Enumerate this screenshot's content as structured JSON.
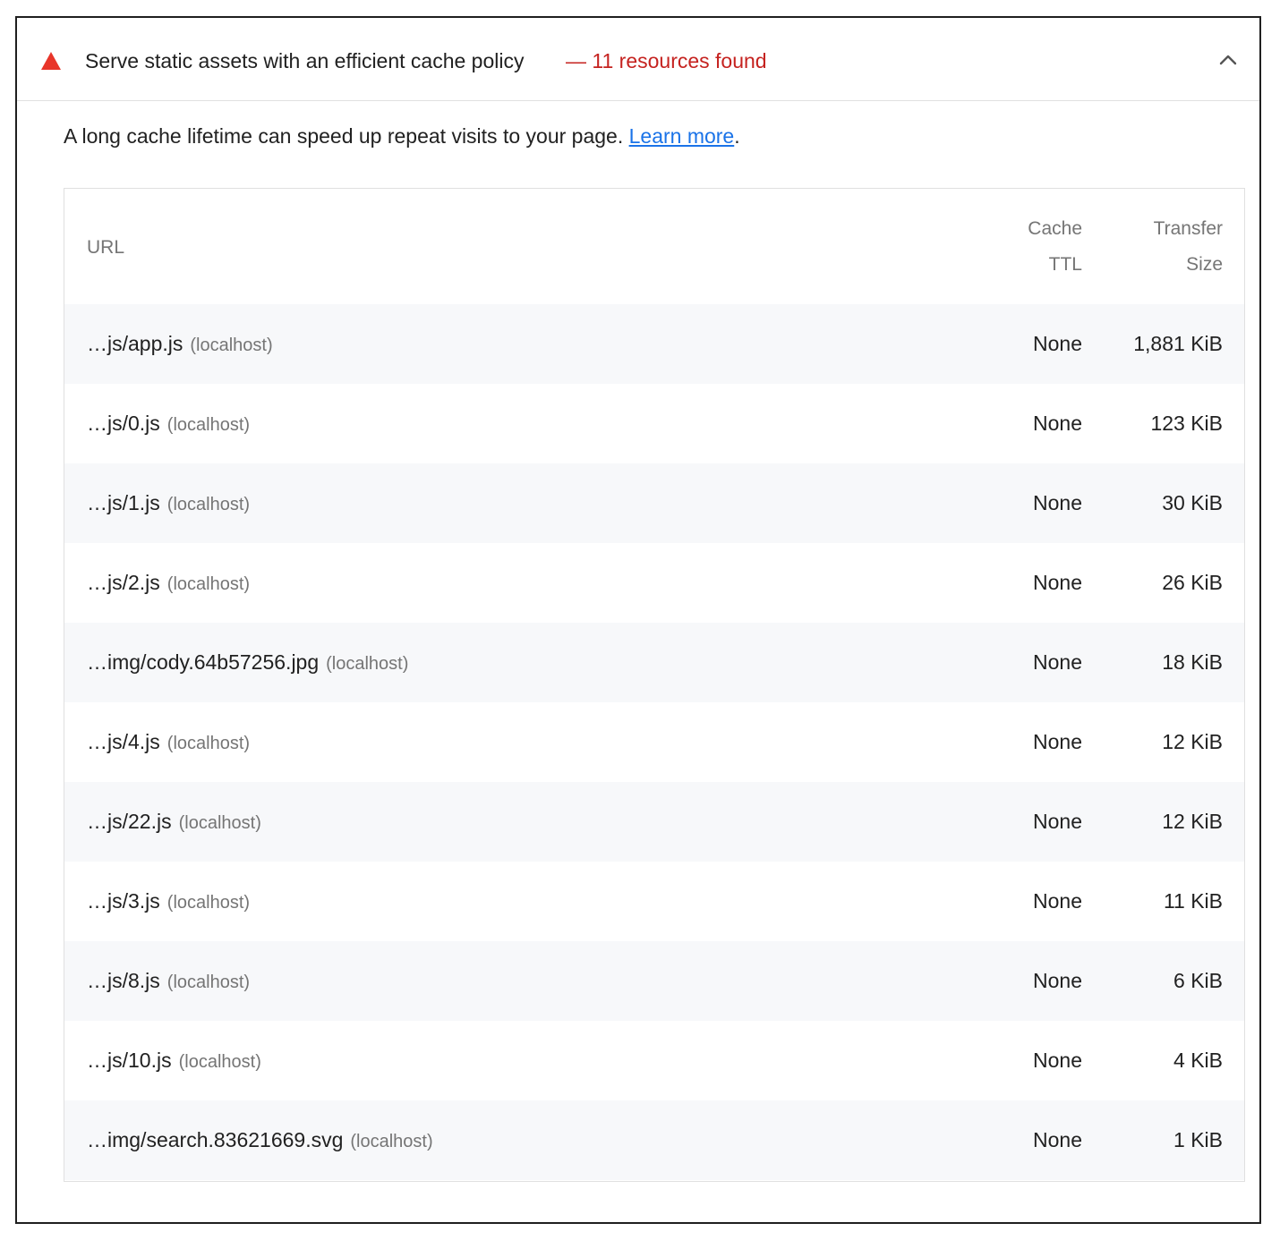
{
  "audit": {
    "title": "Serve static assets with an efficient cache policy",
    "display_value": "— 11 resources found",
    "status_icon": "warning-triangle-icon",
    "status_color": "#e8352a",
    "toggle_icon": "chevron-up-icon",
    "expanded": true
  },
  "description": {
    "text": "A long cache lifetime can speed up repeat visits to your page. ",
    "link_label": "Learn more",
    "suffix": "."
  },
  "table": {
    "headers": {
      "url": "URL",
      "ttl_line1": "Cache",
      "ttl_line2": "TTL",
      "size_line1": "Transfer",
      "size_line2": "Size"
    },
    "rows": [
      {
        "url": "…js/app.js",
        "host": "(localhost)",
        "ttl": "None",
        "size": "1,881 KiB"
      },
      {
        "url": "…js/0.js",
        "host": "(localhost)",
        "ttl": "None",
        "size": "123 KiB"
      },
      {
        "url": "…js/1.js",
        "host": "(localhost)",
        "ttl": "None",
        "size": "30 KiB"
      },
      {
        "url": "…js/2.js",
        "host": "(localhost)",
        "ttl": "None",
        "size": "26 KiB"
      },
      {
        "url": "…img/cody.64b57256.jpg",
        "host": "(localhost)",
        "ttl": "None",
        "size": "18 KiB"
      },
      {
        "url": "…js/4.js",
        "host": "(localhost)",
        "ttl": "None",
        "size": "12 KiB"
      },
      {
        "url": "…js/22.js",
        "host": "(localhost)",
        "ttl": "None",
        "size": "12 KiB"
      },
      {
        "url": "…js/3.js",
        "host": "(localhost)",
        "ttl": "None",
        "size": "11 KiB"
      },
      {
        "url": "…js/8.js",
        "host": "(localhost)",
        "ttl": "None",
        "size": "6 KiB"
      },
      {
        "url": "…js/10.js",
        "host": "(localhost)",
        "ttl": "None",
        "size": "4 KiB"
      },
      {
        "url": "…img/search.83621669.svg",
        "host": "(localhost)",
        "ttl": "None",
        "size": "1 KiB"
      }
    ]
  }
}
